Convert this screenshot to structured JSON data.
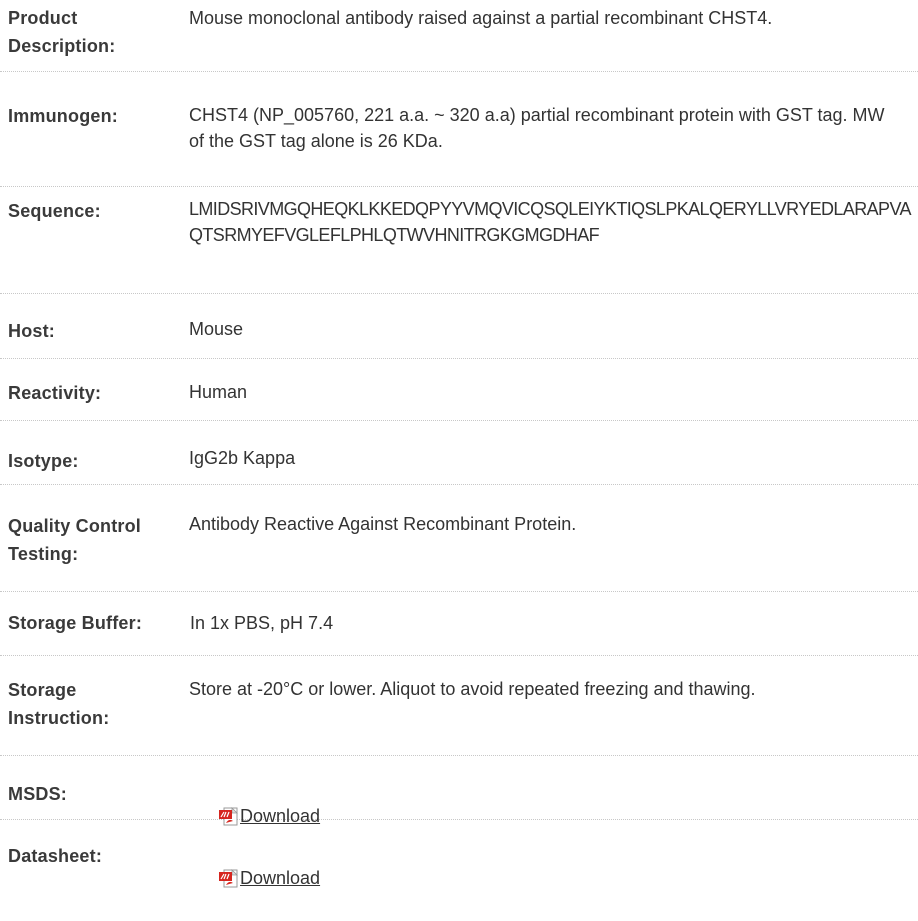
{
  "rows": [
    {
      "label": "Product Description:",
      "value": "Mouse monoclonal antibody raised against a partial recombinant CHST4."
    },
    {
      "label": "Immunogen:",
      "value": "CHST4 (NP_005760, 221 a.a. ~ 320 a.a) partial recombinant protein with GST tag. MW of the GST tag alone is 26 KDa."
    },
    {
      "label": "Sequence:",
      "value": "LMIDSRIVMGQHEQKLKKEDQPYYVMQVICQSQLEIYKTIQSLPKALQERYLLVRYEDLARAPVAQTSRMYEFVGLEFLPHLQTWVHNITRGKGMGDHAF"
    },
    {
      "label": "Host:",
      "value": "Mouse"
    },
    {
      "label": "Reactivity:",
      "value": "Human"
    },
    {
      "label": "Isotype:",
      "value": "IgG2b Kappa"
    },
    {
      "label": "Quality Control Testing:",
      "value": "Antibody Reactive Against Recombinant Protein."
    },
    {
      "label": "Storage Buffer:",
      "value": "In 1x PBS, pH 7.4"
    },
    {
      "label": "Storage Instruction:",
      "value": "Store at -20°C or lower. Aliquot to avoid repeated freezing and thawing."
    },
    {
      "label": "MSDS:",
      "link": "Download",
      "icon": "pdf-icon"
    },
    {
      "label": "Datasheet:",
      "link": "Download",
      "icon": "pdf-icon"
    }
  ]
}
